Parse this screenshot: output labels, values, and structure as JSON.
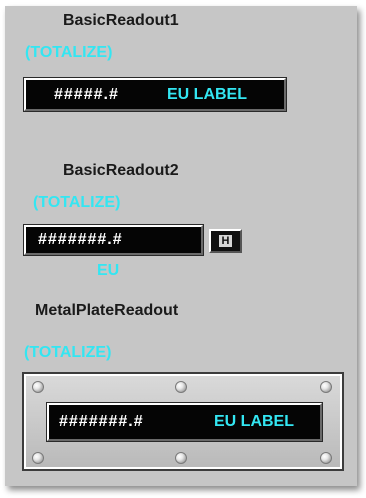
{
  "readout1": {
    "title": "BasicReadout1",
    "totalize": "(TOTALIZE)",
    "value": "#####.#",
    "unit": "EU LABEL"
  },
  "readout2": {
    "title": "BasicReadout2",
    "totalize": "(TOTALIZE)",
    "value": "#######.#",
    "h_button": "H",
    "unit": "EU"
  },
  "metal_plate": {
    "title": "MetalPlateReadout",
    "totalize": "(TOTALIZE)",
    "value": "#######.#",
    "unit": "EU LABEL"
  },
  "colors": {
    "panel": "#c6c6c6",
    "display": "#050505",
    "accent_cyan": "#33e6f2",
    "value_text": "#ffffff"
  }
}
